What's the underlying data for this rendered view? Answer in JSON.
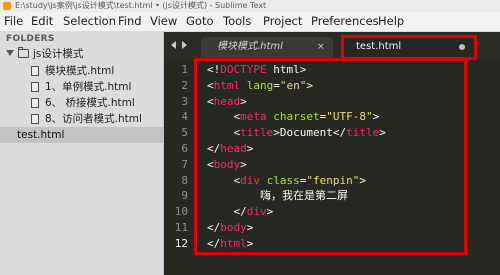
{
  "window": {
    "title": "E:\\study\\js案例\\js设计模式\\test.html • (js设计模式) - Sublime Text"
  },
  "menu": [
    "File",
    "Edit",
    "Selection",
    "Find",
    "View",
    "Goto",
    "Tools",
    "Project",
    "Preferences",
    "Help"
  ],
  "sidebar": {
    "header": "FOLDERS",
    "folder": "js设计模式",
    "files": [
      "模块模式.html",
      "1、单例模式.html",
      "6、 桥接模式.html",
      "8、访问者模式.html",
      "test.html"
    ],
    "selected_file": "test.html"
  },
  "tabs": [
    {
      "label": "模块模式.html",
      "state": "inactive",
      "close_glyph": "×"
    },
    {
      "label": "test.html",
      "state": "active"
    }
  ],
  "editor": {
    "current_line": 12,
    "lines": [
      {
        "n": "1",
        "tokens": [
          {
            "t": "<!",
            "k": "text"
          },
          {
            "t": "DOCTYPE",
            "k": "tag"
          },
          {
            "t": " html>",
            "k": "text"
          }
        ]
      },
      {
        "n": "2",
        "tokens": [
          {
            "t": "<",
            "k": "text"
          },
          {
            "t": "html",
            "k": "tag"
          },
          {
            "t": " lang",
            "k": "attr"
          },
          {
            "t": "=",
            "k": "text"
          },
          {
            "t": "\"en\"",
            "k": "str"
          },
          {
            "t": ">",
            "k": "text"
          }
        ]
      },
      {
        "n": "3",
        "tokens": [
          {
            "t": "<",
            "k": "text"
          },
          {
            "t": "head",
            "k": "tag"
          },
          {
            "t": ">",
            "k": "text"
          }
        ]
      },
      {
        "n": "4",
        "tokens": [
          {
            "t": "    <",
            "k": "text"
          },
          {
            "t": "meta",
            "k": "tag"
          },
          {
            "t": " charset",
            "k": "attr"
          },
          {
            "t": "=",
            "k": "text"
          },
          {
            "t": "\"UTF-8\"",
            "k": "str"
          },
          {
            "t": ">",
            "k": "text"
          }
        ]
      },
      {
        "n": "5",
        "tokens": [
          {
            "t": "    <",
            "k": "text"
          },
          {
            "t": "title",
            "k": "tag"
          },
          {
            "t": ">Document</",
            "k": "text"
          },
          {
            "t": "title",
            "k": "tag"
          },
          {
            "t": ">",
            "k": "text"
          }
        ]
      },
      {
        "n": "6",
        "tokens": [
          {
            "t": "</",
            "k": "text"
          },
          {
            "t": "head",
            "k": "tag"
          },
          {
            "t": ">",
            "k": "text"
          }
        ]
      },
      {
        "n": "7",
        "tokens": [
          {
            "t": "<",
            "k": "text"
          },
          {
            "t": "body",
            "k": "tag"
          },
          {
            "t": ">",
            "k": "text"
          }
        ]
      },
      {
        "n": "8",
        "tokens": [
          {
            "t": "    <",
            "k": "text"
          },
          {
            "t": "div",
            "k": "tag"
          },
          {
            "t": " class",
            "k": "attr"
          },
          {
            "t": "=",
            "k": "text"
          },
          {
            "t": "\"fenpin\"",
            "k": "str"
          },
          {
            "t": ">",
            "k": "text"
          }
        ]
      },
      {
        "n": "9",
        "tokens": [
          {
            "t": "        嗨，我在是第二屏",
            "k": "text"
          }
        ]
      },
      {
        "n": "10",
        "tokens": [
          {
            "t": "    </",
            "k": "text"
          },
          {
            "t": "div",
            "k": "tag"
          },
          {
            "t": ">",
            "k": "text"
          }
        ]
      },
      {
        "n": "11",
        "tokens": [
          {
            "t": "</",
            "k": "text"
          },
          {
            "t": "body",
            "k": "tag"
          },
          {
            "t": ">",
            "k": "text"
          }
        ]
      },
      {
        "n": "12",
        "tokens": [
          {
            "t": "</",
            "k": "text"
          },
          {
            "t": "html",
            "k": "tag"
          },
          {
            "t": ">",
            "k": "text"
          }
        ]
      }
    ]
  },
  "colors": {
    "highlight_box": "#e00000",
    "editor_bg": "#272822",
    "tag": "#f92672",
    "attr": "#a6e22e",
    "string": "#e6db74"
  }
}
